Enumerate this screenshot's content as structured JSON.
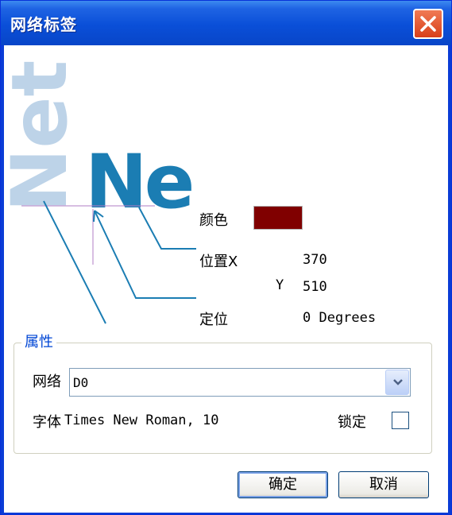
{
  "window": {
    "title": "网络标签"
  },
  "preview": {
    "ghost_text": "Net",
    "main_text": "Ne"
  },
  "fields": {
    "color_label": "颜色",
    "color_value": "#800000",
    "position_label": "位置X",
    "x_value": "370",
    "y_label": "Y",
    "y_value": "510",
    "orientation_label": "定位",
    "orientation_value": "0 Degrees"
  },
  "properties": {
    "group_title": "属性",
    "net_label": "网络",
    "net_value": "D0",
    "font_label": "字体",
    "font_value": "Times New Roman, 10",
    "lock_label": "锁定",
    "lock_checked": false
  },
  "buttons": {
    "ok": "确定",
    "cancel": "取消"
  },
  "colors": {
    "title_bar": "#0a4fd8",
    "accent": "#1b7db3",
    "group_title": "#0046d5"
  }
}
